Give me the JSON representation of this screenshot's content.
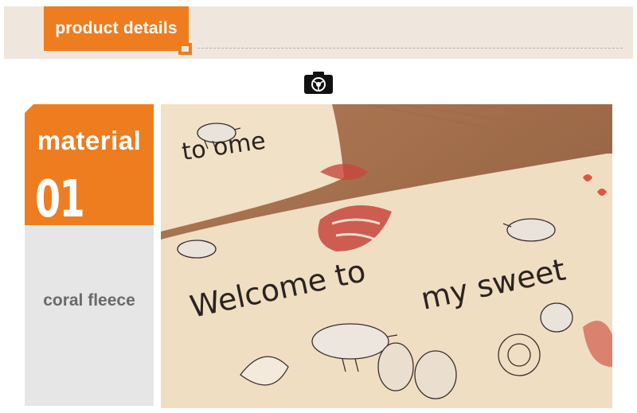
{
  "header": {
    "title": "product details"
  },
  "icons": {
    "camera": "camera-icon"
  },
  "feature": {
    "title": "material",
    "number": "01",
    "value": "coral fleece"
  },
  "photo": {
    "mat_top_text": "to ome",
    "mat_text_line1": "Welcome to",
    "mat_text_line2": "my sweet"
  },
  "colors": {
    "accent": "#ee7d1f",
    "band": "#efe6dd",
    "panel": "#e6e6e6",
    "text_grey": "#6a6a6a"
  }
}
